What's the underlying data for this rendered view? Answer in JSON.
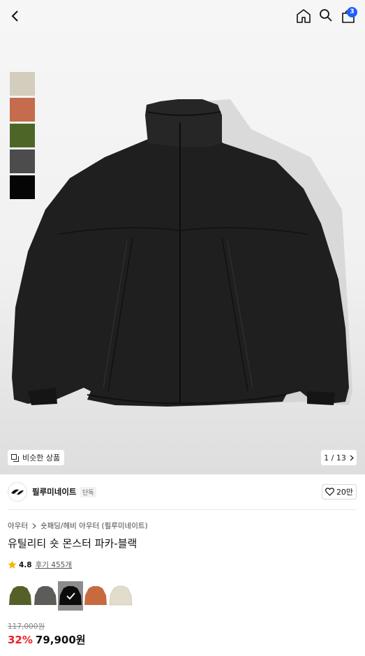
{
  "header": {
    "back_icon": "chevron-left-icon",
    "home_icon": "home-icon",
    "search_icon": "search-icon",
    "bag_icon": "shopping-bag-icon",
    "bag_count": "3",
    "badge_color": "#1f5eff"
  },
  "hero": {
    "swatch_colors": [
      "#d3cdbd",
      "#c46c4b",
      "#4d6627",
      "#4c4c4c",
      "#050505"
    ],
    "similar_label": "비슷한 상품",
    "page_counter": "1 / 13"
  },
  "brand": {
    "name": "필루미네이트",
    "tag": "단독",
    "like_count": "20만"
  },
  "product": {
    "breadcrumb": [
      "아우터",
      "숏패딩/헤비 아우터 (필루미네이트)"
    ],
    "title": "유틸리티 숏 몬스터 파카-블랙",
    "rating": "4.8",
    "reviews": "후기 455개",
    "variant_colors": [
      "#556028",
      "#5c5d58",
      "#151515",
      "#c76a40",
      "#e1dccc"
    ],
    "selected_variant": 2,
    "original_price": "117,000원",
    "discount": "32%",
    "final_price": "79,900원",
    "discount_color": "#f01d26"
  }
}
